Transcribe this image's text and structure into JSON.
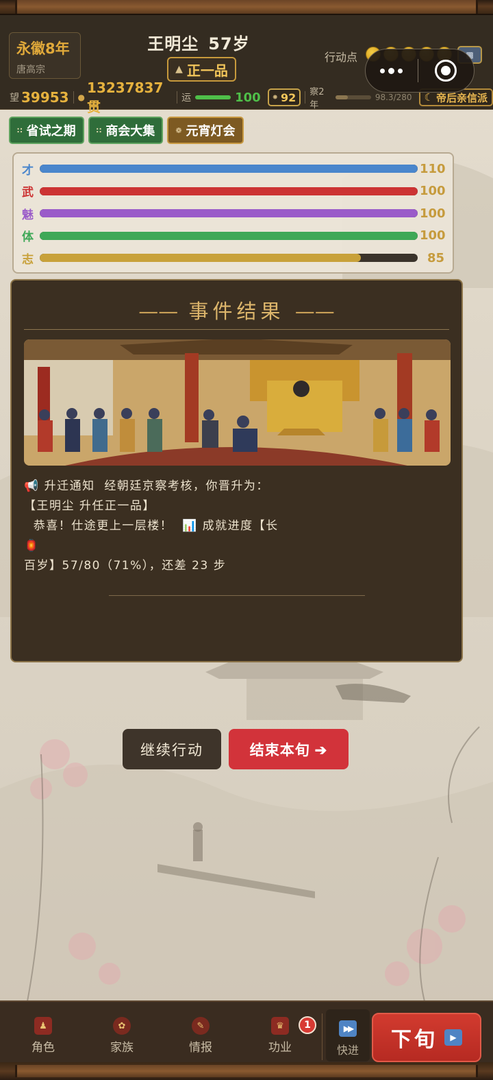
{
  "header": {
    "era": "永徽8年",
    "emperor": "唐高宗",
    "name": "王明尘",
    "age": "57岁",
    "rank": "正一品",
    "action_points_label": "行动点",
    "action_points": 5
  },
  "stats": {
    "prestige_label": "望",
    "prestige": "39953",
    "money": "13237837贯",
    "luck_label": "运",
    "luck": "100",
    "luck_fraction": 1.0,
    "badge_value": "92",
    "inspect_label": "察2年",
    "inspect_value": "98.3/280",
    "inspect_fraction": 0.35,
    "faction": "帝后亲信派"
  },
  "events": [
    {
      "label": "省试之期",
      "style": "green"
    },
    {
      "label": "商会大集",
      "style": "green"
    },
    {
      "label": "元宵灯会",
      "style": "gold"
    }
  ],
  "attributes": [
    {
      "name": "才",
      "value": "110",
      "fraction": 1.0,
      "color": "#4a86cc"
    },
    {
      "name": "武",
      "value": "100",
      "fraction": 1.0,
      "color": "#cc3333"
    },
    {
      "name": "魅",
      "value": "100",
      "fraction": 1.0,
      "color": "#9a5bc9"
    },
    {
      "name": "体",
      "value": "100",
      "fraction": 1.0,
      "color": "#3fa857"
    },
    {
      "name": "志",
      "value": "85",
      "fraction": 0.85,
      "color": "#c8a13a"
    }
  ],
  "event_result": {
    "title": "事件结果",
    "lines": [
      "📢 升迁通知  经朝廷京察考核，你晋升为：",
      "【王明尘 升任正一品】",
      "  恭喜！仕途更上一层楼！  📊 成就进度【长",
      "🏮",
      "百岁】57/80（71%），还差 23 步"
    ]
  },
  "actions": {
    "continue_label": "继续行动",
    "end_label": "结束本旬 ➔"
  },
  "nav": [
    {
      "label": "角色"
    },
    {
      "label": "家族"
    },
    {
      "label": "情报"
    },
    {
      "label": "功业",
      "badge": "1"
    }
  ],
  "fast_forward_label": "快进",
  "next_label": "下旬"
}
